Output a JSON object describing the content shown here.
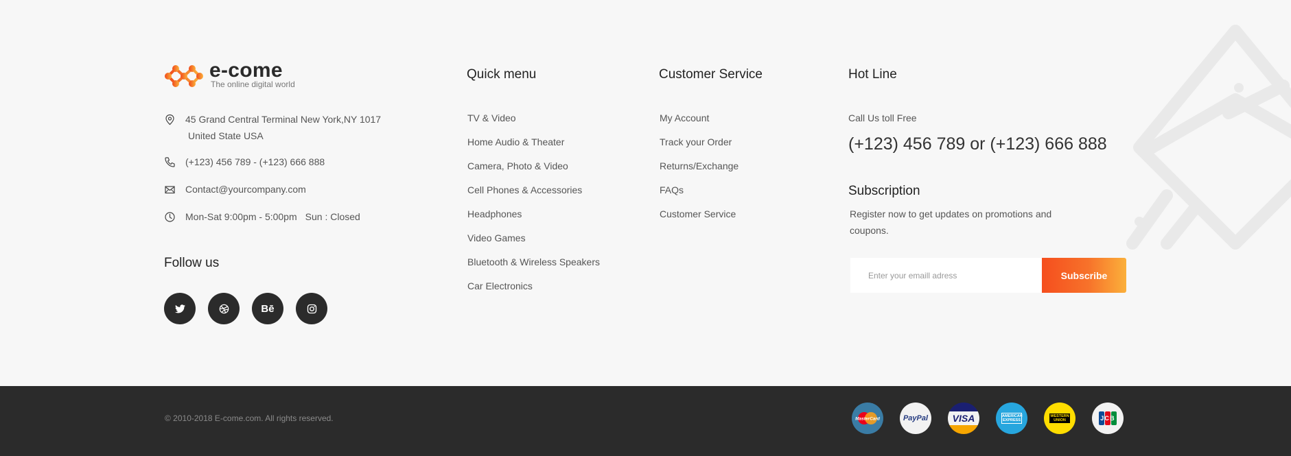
{
  "brand": {
    "name": "e-come",
    "tagline": "The online digital world",
    "logo_icon": "molecule-logo-icon"
  },
  "contact": {
    "address_line1": "45 Grand Central Terminal New York,NY 1017",
    "address_line2": "United State USA",
    "phone": "(+123) 456 789 - (+123) 666 888",
    "email": "Contact@yourcompany.com",
    "hours": "Mon-Sat 9:00pm - 5:00pm",
    "closed": "Sun : Closed"
  },
  "follow": {
    "title": "Follow us",
    "networks": [
      {
        "name": "twitter",
        "icon": "twitter-icon"
      },
      {
        "name": "dribbble",
        "icon": "dribbble-icon"
      },
      {
        "name": "behance",
        "icon": "behance-icon",
        "glyph": "Bē"
      },
      {
        "name": "instagram",
        "icon": "instagram-icon"
      }
    ]
  },
  "quick_menu": {
    "title": "Quick menu",
    "items": [
      "TV & Video",
      "Home Audio & Theater",
      "Camera, Photo & Video",
      "Cell Phones & Accessories",
      "Headphones",
      "Video Games",
      "Bluetooth & Wireless Speakers",
      "Car Electronics"
    ]
  },
  "customer_service": {
    "title": "Customer Service",
    "items": [
      "My Account",
      "Track your Order",
      "Returns/Exchange",
      "FAQs",
      "Customer Service"
    ]
  },
  "hotline": {
    "title": "Hot Line",
    "subtitle": "Call Us toll Free",
    "number": "(+123) 456 789 or (+123) 666 888"
  },
  "subscription": {
    "title": "Subscription",
    "text": "Register now to get updates on promotions and coupons.",
    "placeholder": "Enter your emaill adress",
    "button": "Subscribe"
  },
  "copyright": "© 2010-2018 E-come.com. All rights reserved.",
  "payments": [
    {
      "name": "MasterCard",
      "icon": "mastercard-icon",
      "bg": "#3a7ca5"
    },
    {
      "name": "PayPal",
      "icon": "paypal-icon",
      "bg": "#f2f2f2"
    },
    {
      "name": "VISA",
      "icon": "visa-icon",
      "bg": "#f2f2f2"
    },
    {
      "name": "AMERICAN EXPRESS",
      "icon": "amex-icon",
      "bg": "#27a6de"
    },
    {
      "name": "WESTERN UNION",
      "icon": "western-union-icon",
      "bg": "#ffdd00"
    },
    {
      "name": "JCB",
      "icon": "jcb-icon",
      "bg": "#f2f2f2"
    }
  ],
  "colors": {
    "accent_start": "#f54e1e",
    "accent_end": "#fbb03b",
    "dark": "#2b2b2b",
    "background": "#f7f7f7"
  }
}
